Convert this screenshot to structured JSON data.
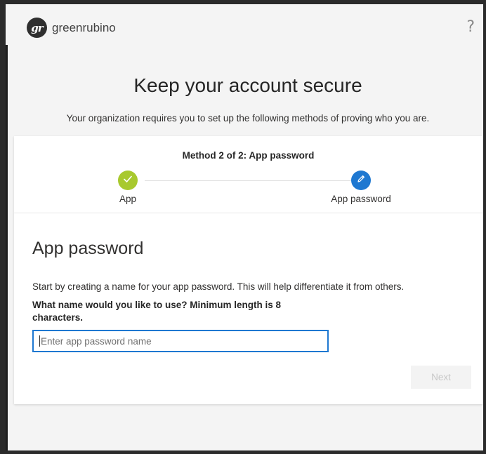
{
  "header": {
    "logo_text": "gr",
    "brand_name": "greenrubino",
    "help_icon": "question-mark-icon",
    "help_glyph": "?"
  },
  "page": {
    "title": "Keep your account secure",
    "subtitle": "Your organization requires you to set up the following methods of proving who you are."
  },
  "progress": {
    "method_label": "Method 2 of 2: App password",
    "steps": [
      {
        "label": "App",
        "status": "complete",
        "icon": "checkmark-icon",
        "color": "#a8c92e"
      },
      {
        "label": "App password",
        "status": "current",
        "icon": "pencil-icon",
        "color": "#1e78d1"
      }
    ]
  },
  "form": {
    "section_title": "App password",
    "description": "Start by creating a name for your app password. This will help differentiate it from others.",
    "question": "What name would you like to use? Minimum length is 8 characters.",
    "input_placeholder": "Enter app password name",
    "input_value": "",
    "next_label": "Next",
    "next_enabled": false
  },
  "colors": {
    "accent": "#1e78d1",
    "success": "#a8c92e"
  }
}
